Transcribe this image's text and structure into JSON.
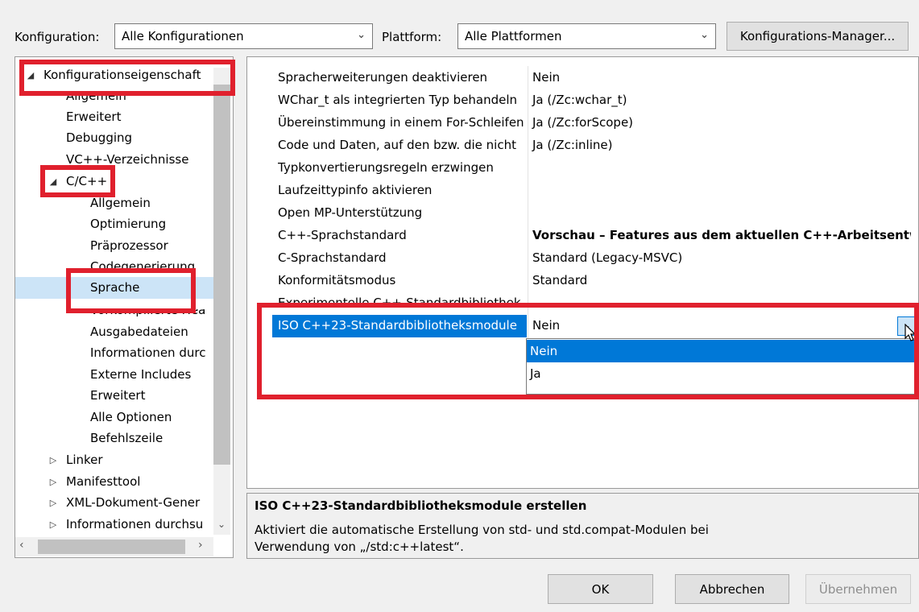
{
  "toolbar": {
    "config_label": "Konfiguration:",
    "config_value": "Alle Konfigurationen",
    "platform_label": "Plattform:",
    "platform_value": "Alle Plattformen",
    "manager_button": "Konfigurations-Manager..."
  },
  "tree": {
    "root": "Konfigurationseigenschaft",
    "items": [
      "Allgemein",
      "Erweitert",
      "Debugging",
      "VC++-Verzeichnisse",
      "C/C++",
      "Allgemein",
      "Optimierung",
      "Präprozessor",
      "Codegenerierung",
      "Sprache",
      "Vorkompilierte Hea",
      "Ausgabedateien",
      "Informationen durc",
      "Externe Includes",
      "Erweitert",
      "Alle Optionen",
      "Befehlszeile",
      "Linker",
      "Manifesttool",
      "XML-Dokument-Gener",
      "Informationen durchsu"
    ]
  },
  "properties": [
    {
      "name": "Spracherweiterungen deaktivieren",
      "value": "Nein"
    },
    {
      "name": "WChar_t als integrierten Typ behandeln",
      "value": "Ja (/Zc:wchar_t)"
    },
    {
      "name": "Übereinstimmung in einem For-Schleifen",
      "value": "Ja (/Zc:forScope)"
    },
    {
      "name": "Code und Daten, auf den bzw. die nicht",
      "value": "Ja (/Zc:inline)"
    },
    {
      "name": "Typkonvertierungsregeln erzwingen",
      "value": ""
    },
    {
      "name": "Laufzeittypinfo aktivieren",
      "value": ""
    },
    {
      "name": "Open MP-Unterstützung",
      "value": ""
    },
    {
      "name": "C++-Sprachstandard",
      "value": "Vorschau – Features aus dem aktuellen C++-Arbeitsentwurf"
    },
    {
      "name": "C-Sprachstandard",
      "value": "Standard (Legacy-MSVC)"
    },
    {
      "name": "Konformitätsmodus",
      "value": "Standard"
    },
    {
      "name": "Experimentelle C++-Standardbibliothek",
      "value": ""
    },
    {
      "name": "ISO C++23-Standardbibliotheksmodule",
      "value": "Nein"
    }
  ],
  "dropdown": {
    "options": [
      "Nein",
      "Ja"
    ],
    "selected": "Nein"
  },
  "description": {
    "title": "ISO C++23-Standardbibliotheksmodule erstellen",
    "text": "Aktiviert die automatische Erstellung von std- und std.compat-Modulen bei Verwendung von „/std:c++latest“."
  },
  "buttons": {
    "ok": "OK",
    "cancel": "Abbrechen",
    "apply": "Übernehmen"
  },
  "colors": {
    "selection": "#0078d7",
    "highlight_box": "#e0202d",
    "tree_selected": "#cce4f7"
  }
}
